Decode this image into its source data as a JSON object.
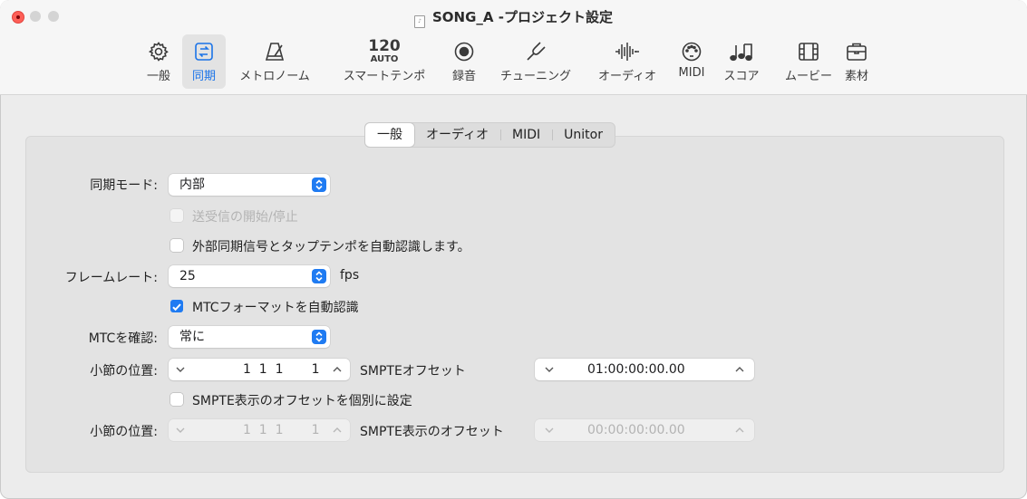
{
  "window": {
    "title": "SONG_A -プロジェクト設定"
  },
  "toolbar": {
    "items": [
      {
        "label": "一般",
        "icon": "gear-icon"
      },
      {
        "label": "同期",
        "icon": "sync-icon"
      },
      {
        "label": "メトロノーム",
        "icon": "metronome-icon"
      },
      {
        "label": "スマートテンポ",
        "icon": "tempo-icon"
      },
      {
        "label": "録音",
        "icon": "record-icon"
      },
      {
        "label": "チューニング",
        "icon": "tuning-fork-icon"
      },
      {
        "label": "オーディオ",
        "icon": "waveform-icon"
      },
      {
        "label": "MIDI",
        "icon": "midi-port-icon"
      },
      {
        "label": "スコア",
        "icon": "notes-icon"
      },
      {
        "label": "ムービー",
        "icon": "film-icon"
      },
      {
        "label": "素材",
        "icon": "briefcase-icon"
      }
    ],
    "selected": "同期",
    "tempo_value": "120",
    "tempo_mode": "AUTO"
  },
  "tabs": {
    "items": [
      "一般",
      "オーディオ",
      "MIDI",
      "Unitor"
    ],
    "selected": "一般"
  },
  "form": {
    "sync_mode": {
      "label": "同期モード:",
      "value": "内部"
    },
    "send_start_stop": {
      "label": "送受信の開始/停止",
      "checked": false,
      "enabled": false
    },
    "auto_detect": {
      "label": "外部同期信号とタップテンポを自動認識します。",
      "checked": false
    },
    "frame_rate": {
      "label": "フレームレート:",
      "value": "25",
      "unit": "fps"
    },
    "mtc_auto": {
      "label": "MTCフォーマットを自動認識",
      "checked": true
    },
    "validate_mtc": {
      "label": "MTCを確認:",
      "value": "常に"
    },
    "bar_position": {
      "label": "小節の位置:",
      "value": "1  1  1       1"
    },
    "smpte_offset": {
      "label": "SMPTEオフセット",
      "value": "01:00:00:00.00"
    },
    "separate_display": {
      "label": "SMPTE表示のオフセットを個別に設定",
      "checked": false
    },
    "bar_position_2": {
      "label": "小節の位置:",
      "value": "1  1  1       1"
    },
    "smpte_display_offset": {
      "label": "SMPTE表示のオフセット",
      "value": "00:00:00:00.00"
    }
  },
  "colors": {
    "accent": "#1f7bf2",
    "close": "#fe5f57"
  }
}
